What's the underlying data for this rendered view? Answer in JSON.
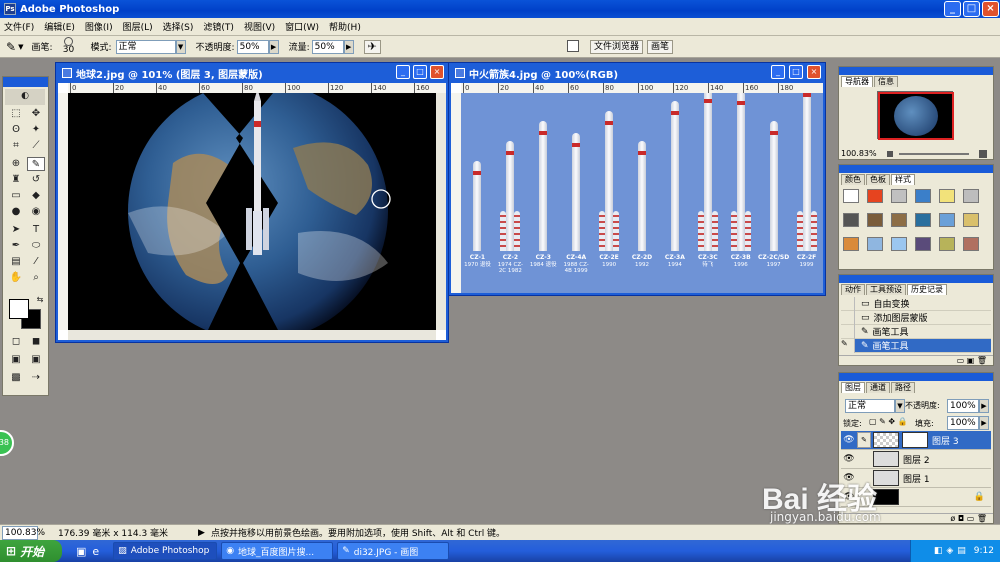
{
  "app": {
    "title": "Adobe Photoshop"
  },
  "menu": [
    "文件(F)",
    "编辑(E)",
    "图像(I)",
    "图层(L)",
    "选择(S)",
    "滤镜(T)",
    "视图(V)",
    "窗口(W)",
    "帮助(H)"
  ],
  "options": {
    "brush_label": "画笔:",
    "brush_size": "30",
    "mode_label": "模式:",
    "mode_value": "正常",
    "opacity_label": "不透明度:",
    "opacity_value": "50%",
    "flow_label": "流量:",
    "flow_value": "50%",
    "tab_file_browser": "文件浏览器",
    "tab_brushes": "画笔"
  },
  "doc1": {
    "title": "地球2.jpg @ 101% (图层 3, 图层蒙版)",
    "ruler_marks": [
      "0",
      "20",
      "40",
      "60",
      "80",
      "100",
      "120",
      "140",
      "160"
    ]
  },
  "doc2": {
    "title": "中火箭族4.jpg @ 100%(RGB)",
    "ruler_marks": [
      "0",
      "20",
      "40",
      "60",
      "80",
      "100",
      "120",
      "140",
      "160",
      "180"
    ],
    "rockets": [
      {
        "name": "CZ-1",
        "info": "1970 退役"
      },
      {
        "name": "CZ-2",
        "info": "1974 CZ-2C 1982"
      },
      {
        "name": "CZ-3",
        "info": "1984 退役"
      },
      {
        "name": "CZ-4A",
        "info": "1988 CZ-4B 1999"
      },
      {
        "name": "CZ-2E",
        "info": "1990"
      },
      {
        "name": "CZ-2D",
        "info": "1992"
      },
      {
        "name": "CZ-3A",
        "info": "1994"
      },
      {
        "name": "CZ-3C",
        "info": "待飞"
      },
      {
        "name": "CZ-3B",
        "info": "1996"
      },
      {
        "name": "CZ-2C/SD",
        "info": "1997"
      },
      {
        "name": "CZ-2F",
        "info": "1999"
      }
    ]
  },
  "navigator": {
    "tab1": "导航器",
    "tab2": "信息",
    "zoom": "100.83%"
  },
  "color_panel": {
    "tab1": "颜色",
    "tab2": "色板",
    "tab3": "样式"
  },
  "history_panel": {
    "tab1": "动作",
    "tab2": "工具预设",
    "tab3": "历史记录",
    "items": [
      "自由变换",
      "添加图层蒙版",
      "画笔工具",
      "画笔工具"
    ]
  },
  "layers_panel": {
    "tab1": "图层",
    "tab2": "通道",
    "tab3": "路径",
    "blend": "正常",
    "opacity_label": "不透明度:",
    "opacity": "100%",
    "lock_label": "锁定:",
    "fill_label": "填充:",
    "fill": "100%",
    "layers": [
      "图层 3",
      "图层 2",
      "图层 1"
    ]
  },
  "status": {
    "zoom": "100.83%",
    "size": "176.39 毫米 x 114.3 毫米",
    "hint": "点按并拖移以用前景色绘画。要用附加选项，使用 Shift、Alt 和 Ctrl 键。"
  },
  "taskbar": {
    "start": "开始",
    "tasks": [
      "Adobe Photoshop",
      "地球_百度图片搜...",
      "di32.JPG - 画图"
    ],
    "time": "9:12"
  },
  "watermark": {
    "brand": "Bai 经验",
    "url": "jingyan.baidu.com"
  },
  "colors": {
    "title_blue": "#0a53d8",
    "panel_bg": "#ece9d8",
    "workspace": "#8d8a87",
    "rocket_bg": "#6f93d6",
    "selected_row": "#316ac5"
  }
}
